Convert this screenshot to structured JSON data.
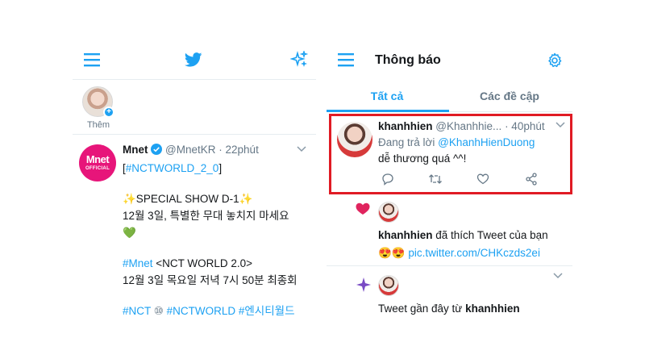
{
  "left": {
    "icons": {
      "menu": "hamburger-icon",
      "logo": "twitter-bird-icon",
      "top_tweets": "sparkle-icon"
    },
    "fleet": {
      "label": "Thêm"
    },
    "tweet": {
      "avatar_text_line1": "Mnet",
      "avatar_text_line2": "OFFICIAL",
      "name": "Mnet",
      "handle": "@MnetKR",
      "time": "· 22phút",
      "lines": [
        "[#NCTWORLD_2_0]",
        "",
        "✨SPECIAL SHOW D-1✨",
        "12월 3일, 특별한 무대 놓치지 마세요",
        "💚",
        "",
        "#Mnet <NCT WORLD 2.0>",
        "12월 3일 목요일 저녁 7시 50분 최종회",
        "",
        "#NCT ⑩  #NCTWORLD #엔시티월드"
      ],
      "l0_a": "[",
      "l0_b": "#NCTWORLD_2_0",
      "l0_c": "]",
      "l2": "✨SPECIAL SHOW D-1✨",
      "l3": "12월 3일, 특별한 무대 놓치지 마세요",
      "l4": "💚",
      "l6_a": "#Mnet",
      "l6_b": " <NCT WORLD 2.0>",
      "l7": "12월 3일 목요일 저녁 7시 50분 최종회",
      "l9_a": "#NCT",
      "l9_b": " ⑩  ",
      "l9_c": "#NCTWORLD #엔시티월드"
    }
  },
  "right": {
    "title": "Thông báo",
    "tabs": [
      {
        "label": "Tất cả",
        "active": true
      },
      {
        "label": "Các đề cập",
        "active": false
      }
    ],
    "reply": {
      "name": "khanhhien",
      "handle": "@Khanhhie...",
      "time": "· 40phút",
      "replying_prefix": "Đang trả lời ",
      "replying_handle": "@KhanhHienDuong",
      "text": "dễ thương quá ^^!"
    },
    "like": {
      "name": "khanhhien",
      "action": " đã thích Tweet của bạn",
      "emoji": "😍😍",
      "link": "pic.twitter.com/CHKczds2ei"
    },
    "recent": {
      "prefix": "Tweet gần đây từ ",
      "name": "khanhhien"
    }
  },
  "colors": {
    "accent": "#1da1f2",
    "highlight_border": "#e01b24",
    "heart": "#e0245e",
    "sparkle": "#794bc4",
    "mnet": "#e7157a"
  }
}
